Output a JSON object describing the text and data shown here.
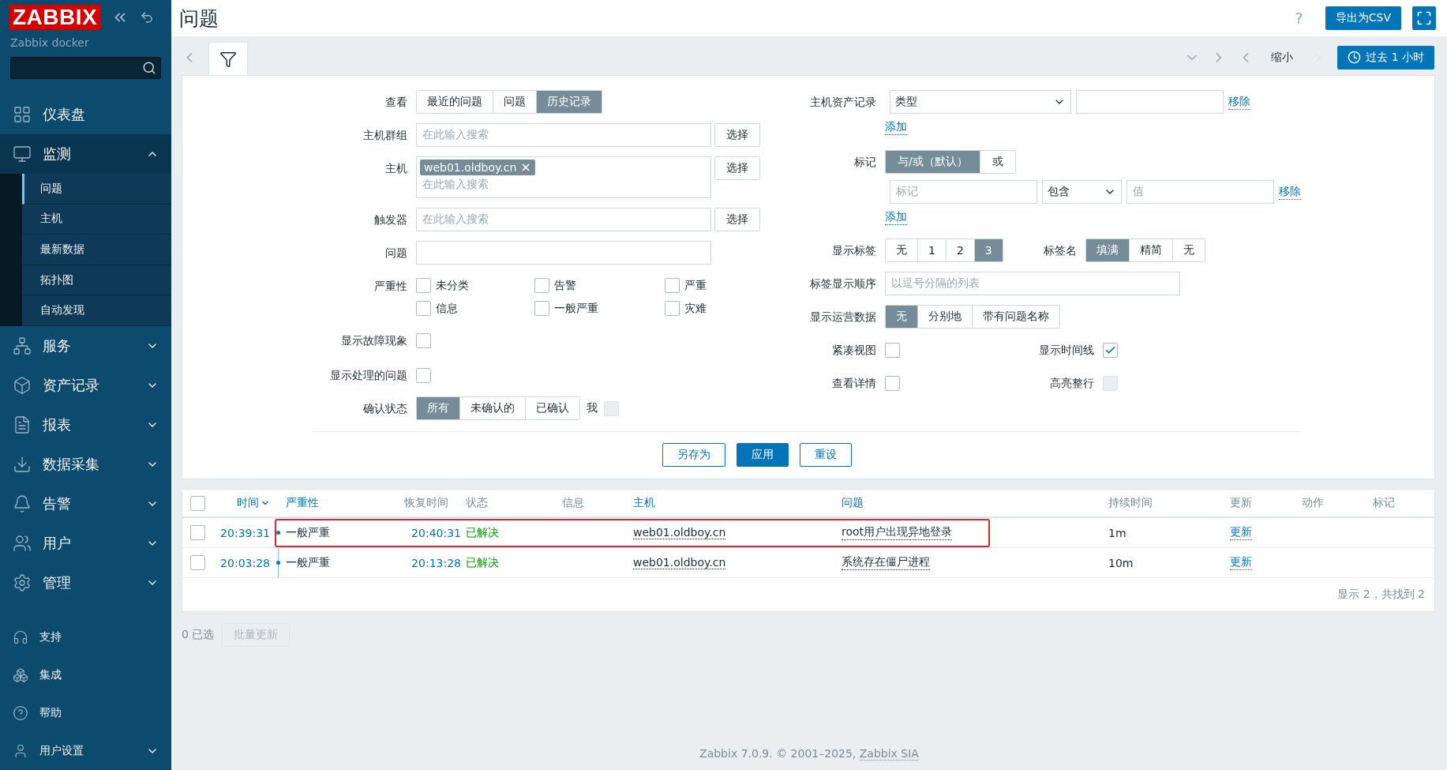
{
  "sidebar": {
    "logo": "ZABBIX",
    "server": "Zabbix docker",
    "menu": [
      {
        "label": "仪表盘"
      },
      {
        "label": "监测",
        "expanded": true,
        "children": [
          {
            "label": "问题",
            "selected": true
          },
          {
            "label": "主机",
            "selected": false
          },
          {
            "label": "最新数据",
            "selected": false
          },
          {
            "label": "拓扑图",
            "selected": false
          },
          {
            "label": "自动发现",
            "selected": false
          }
        ]
      },
      {
        "label": "服务",
        "expanded": false
      },
      {
        "label": "资产记录",
        "expanded": false
      },
      {
        "label": "报表",
        "expanded": false
      },
      {
        "label": "数据采集",
        "expanded": false
      },
      {
        "label": "告警",
        "expanded": false
      },
      {
        "label": "用户",
        "expanded": false
      },
      {
        "label": "管理",
        "expanded": false
      }
    ],
    "bottom": [
      {
        "label": "支持"
      },
      {
        "label": "集成"
      },
      {
        "label": "帮助"
      },
      {
        "label": "用户设置",
        "expanded": false
      }
    ]
  },
  "header": {
    "title": "问题",
    "help": "?",
    "export_button": "导出为CSV"
  },
  "timebar": {
    "zoom_out": "缩小",
    "time_button": "过去 1 小时"
  },
  "filter": {
    "view": {
      "label": "查看",
      "options": [
        {
          "label": "最近的问题",
          "selected": false
        },
        {
          "label": "问题",
          "selected": false
        },
        {
          "label": "历史记录",
          "selected": true
        }
      ]
    },
    "host_groups": {
      "label": "主机群组",
      "placeholder": "在此输入搜索",
      "button": "选择"
    },
    "hosts": {
      "label": "主机",
      "tags": [
        "web01.oldboy.cn"
      ],
      "placeholder": "在此输入搜索",
      "button": "选择"
    },
    "triggers": {
      "label": "触发器",
      "placeholder": "在此输入搜索",
      "button": "选择"
    },
    "problem": {
      "label": "问题"
    },
    "severity": {
      "label": "严重性",
      "options": [
        {
          "label": "未分类",
          "checked": false
        },
        {
          "label": "告警",
          "checked": false
        },
        {
          "label": "严重",
          "checked": false
        },
        {
          "label": "信息",
          "checked": false
        },
        {
          "label": "一般严重",
          "checked": false
        },
        {
          "label": "灾难",
          "checked": false
        }
      ]
    },
    "show_symptoms": {
      "label": "显示故障现象",
      "checked": false
    },
    "show_suppressed": {
      "label": "显示处理的问题",
      "checked": false
    },
    "acknowledgement": {
      "label": "确认状态",
      "options": [
        {
          "label": "所有",
          "selected": true
        },
        {
          "label": "未确认的",
          "selected": false
        },
        {
          "label": "已确认",
          "selected": false
        }
      ],
      "me": {
        "label": "我",
        "checked": false,
        "disabled": true
      }
    },
    "inventory": {
      "label": "主机资产记录",
      "select": "类型",
      "remove": "移除",
      "add": "添加"
    },
    "tags": {
      "label": "标记",
      "options": [
        {
          "label": "与/或（默认）",
          "selected": true
        },
        {
          "label": "或",
          "selected": false
        }
      ],
      "tag_placeholder": "标记",
      "operator": "包含",
      "value_placeholder": "值",
      "remove": "移除",
      "add": "添加"
    },
    "show_tags": {
      "label": "显示标签",
      "options": [
        {
          "label": "无",
          "selected": false
        },
        {
          "label": "1",
          "selected": false
        },
        {
          "label": "2",
          "selected": false
        },
        {
          "label": "3",
          "selected": true
        }
      ]
    },
    "tag_name": {
      "label": "标签名",
      "options": [
        {
          "label": "填满",
          "selected": true
        },
        {
          "label": "精简",
          "selected": false
        },
        {
          "label": "无",
          "selected": false
        }
      ]
    },
    "tag_priority": {
      "label": "标签显示顺序",
      "placeholder": "以逗号分隔的列表"
    },
    "show_opdata": {
      "label": "显示运营数据",
      "options": [
        {
          "label": "无",
          "selected": true
        },
        {
          "label": "分别地",
          "selected": false
        },
        {
          "label": "带有问题名称",
          "selected": false
        }
      ]
    },
    "compact_view": {
      "label": "紧凑视图",
      "checked": false
    },
    "show_timeline": {
      "label": "显示时间线",
      "checked": true
    },
    "show_details": {
      "label": "查看详情",
      "checked": false
    },
    "highlight_row": {
      "label": "高亮整行",
      "checked": false,
      "disabled": true
    },
    "buttons": [
      {
        "label": "另存为",
        "kind": "secondary"
      },
      {
        "label": "应用",
        "kind": "primary"
      },
      {
        "label": "重设",
        "kind": "secondary"
      }
    ]
  },
  "table": {
    "select_all": {
      "checked": false
    },
    "columns": [
      {
        "label": "时间",
        "link": true,
        "sorted": true
      },
      {
        "label": "严重性",
        "link": true,
        "sorted": false
      },
      {
        "label": "恢复时间",
        "link": false,
        "sorted": false
      },
      {
        "label": "状态",
        "link": false,
        "sorted": false
      },
      {
        "label": "信息",
        "link": false,
        "sorted": false
      },
      {
        "label": "主机",
        "link": true,
        "sorted": false
      },
      {
        "label": "问题",
        "link": true,
        "sorted": false
      },
      {
        "label": "持续时间",
        "link": false,
        "sorted": false
      },
      {
        "label": "更新",
        "link": false,
        "sorted": false
      },
      {
        "label": "动作",
        "link": false,
        "sorted": false
      },
      {
        "label": "标记",
        "link": false,
        "sorted": false
      }
    ],
    "rows": [
      {
        "checked": false,
        "time": "20:39:31",
        "severity": "一般严重",
        "recovery_time": "20:40:31",
        "status": "已解决",
        "host": "web01.oldboy.cn",
        "problem": "root用户出现异地登录",
        "duration": "1m",
        "update": "更新",
        "highlighted": true
      },
      {
        "checked": false,
        "time": "20:03:28",
        "severity": "一般严重",
        "recovery_time": "20:13:28",
        "status": "已解决",
        "host": "web01.oldboy.cn",
        "problem": "系统存在僵尸进程",
        "duration": "10m",
        "update": "更新",
        "highlighted": false
      }
    ],
    "summary": "显示 2，共找到 2"
  },
  "bulk": {
    "selected": "0 已选",
    "button": "批量更新",
    "disabled": true
  },
  "footer": {
    "text": "Zabbix 7.0.9. © 2001–2025, ",
    "link": "Zabbix SIA"
  }
}
